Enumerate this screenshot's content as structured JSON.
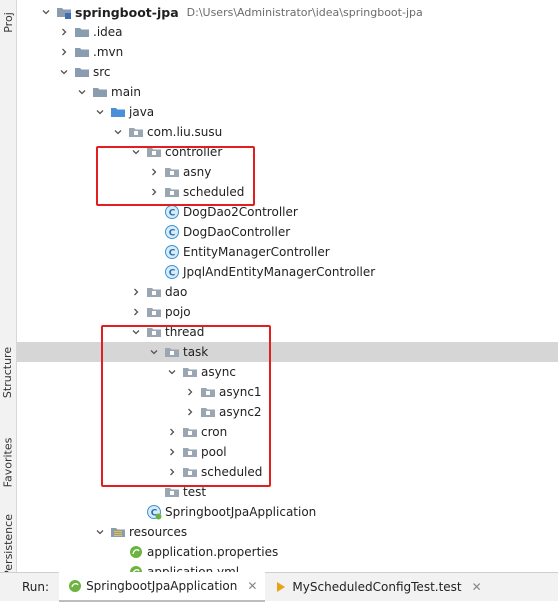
{
  "sidebar_tabs": {
    "project": "Proj",
    "structure": "Structure",
    "favorites": "Favorites",
    "persistence": "Persistence"
  },
  "tree": [
    {
      "id": "root",
      "label": "springboot-jpa",
      "path": "D:\\Users\\Administrator\\idea\\springboot-jpa",
      "indent": 0,
      "arrow": "down",
      "icon": "module-folder",
      "bold": true
    },
    {
      "id": "idea",
      "label": ".idea",
      "indent": 1,
      "arrow": "right",
      "icon": "folder"
    },
    {
      "id": "mvn",
      "label": ".mvn",
      "indent": 1,
      "arrow": "right",
      "icon": "folder"
    },
    {
      "id": "src",
      "label": "src",
      "indent": 1,
      "arrow": "down",
      "icon": "folder"
    },
    {
      "id": "main",
      "label": "main",
      "indent": 2,
      "arrow": "down",
      "icon": "folder"
    },
    {
      "id": "java",
      "label": "java",
      "indent": 3,
      "arrow": "down",
      "icon": "source-folder"
    },
    {
      "id": "pkg",
      "label": "com.liu.susu",
      "indent": 4,
      "arrow": "down",
      "icon": "package"
    },
    {
      "id": "controller",
      "label": "controller",
      "indent": 5,
      "arrow": "down",
      "icon": "package"
    },
    {
      "id": "asny",
      "label": "asny",
      "indent": 6,
      "arrow": "right",
      "icon": "package"
    },
    {
      "id": "ctrl-scheduled",
      "label": "scheduled",
      "indent": 6,
      "arrow": "right",
      "icon": "package"
    },
    {
      "id": "dog2",
      "label": "DogDao2Controller",
      "indent": 6,
      "arrow": "none",
      "icon": "class"
    },
    {
      "id": "dog",
      "label": "DogDaoController",
      "indent": 6,
      "arrow": "none",
      "icon": "class"
    },
    {
      "id": "em",
      "label": "EntityManagerController",
      "indent": 6,
      "arrow": "none",
      "icon": "class"
    },
    {
      "id": "jpql",
      "label": "JpqlAndEntityManagerController",
      "indent": 6,
      "arrow": "none",
      "icon": "class"
    },
    {
      "id": "dao",
      "label": "dao",
      "indent": 5,
      "arrow": "right",
      "icon": "package"
    },
    {
      "id": "pojo",
      "label": "pojo",
      "indent": 5,
      "arrow": "right",
      "icon": "package"
    },
    {
      "id": "thread",
      "label": "thread",
      "indent": 5,
      "arrow": "down",
      "icon": "package"
    },
    {
      "id": "task",
      "label": "task",
      "indent": 6,
      "arrow": "down",
      "icon": "package",
      "selected": true
    },
    {
      "id": "async",
      "label": "async",
      "indent": 7,
      "arrow": "down",
      "icon": "package"
    },
    {
      "id": "async1",
      "label": "async1",
      "indent": 8,
      "arrow": "right",
      "icon": "package"
    },
    {
      "id": "async2",
      "label": "async2",
      "indent": 8,
      "arrow": "right",
      "icon": "package"
    },
    {
      "id": "cron",
      "label": "cron",
      "indent": 7,
      "arrow": "right",
      "icon": "package"
    },
    {
      "id": "pool",
      "label": "pool",
      "indent": 7,
      "arrow": "right",
      "icon": "package"
    },
    {
      "id": "task-scheduled",
      "label": "scheduled",
      "indent": 7,
      "arrow": "right",
      "icon": "package"
    },
    {
      "id": "test",
      "label": "test",
      "indent": 6,
      "arrow": "none",
      "icon": "package"
    },
    {
      "id": "app",
      "label": "SpringbootJpaApplication",
      "indent": 5,
      "arrow": "none",
      "icon": "spring-class"
    },
    {
      "id": "resources",
      "label": "resources",
      "indent": 3,
      "arrow": "down",
      "icon": "resources-folder"
    },
    {
      "id": "props",
      "label": "application.properties",
      "indent": 4,
      "arrow": "none",
      "icon": "spring-file"
    },
    {
      "id": "yml",
      "label": "application.yml",
      "indent": 4,
      "arrow": "none",
      "icon": "spring-file"
    }
  ],
  "run_bar": {
    "label": "Run:",
    "tabs": [
      {
        "label": "SpringbootJpaApplication",
        "icon": "spring-run-icon",
        "active": true
      },
      {
        "label": "MyScheduledConfigTest.test",
        "icon": "test-run-icon",
        "active": false
      }
    ]
  },
  "colors": {
    "folder": "#8a9cb0",
    "package": "#8d9aa7",
    "class": "#3d94d3",
    "spring": "#6db33f",
    "highlight": "#e02020",
    "selected_row": "#d6d6d6"
  }
}
